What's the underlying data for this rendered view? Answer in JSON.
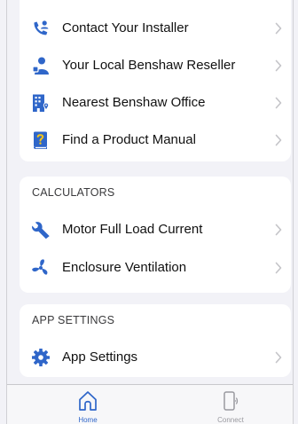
{
  "support": {
    "items": [
      {
        "label": "Contact Your Installer",
        "icon": "phone-person-icon"
      },
      {
        "label": "Your Local Benshaw Reseller",
        "icon": "person-icon"
      },
      {
        "label": "Nearest Benshaw Office",
        "icon": "office-building-icon"
      },
      {
        "label": "Find a Product Manual",
        "icon": "manual-question-icon"
      }
    ]
  },
  "calculators": {
    "header": "CALCULATORS",
    "items": [
      {
        "label": "Motor Full Load Current",
        "icon": "wrench-icon"
      },
      {
        "label": "Enclosure Ventilation",
        "icon": "fan-icon"
      }
    ]
  },
  "app_settings": {
    "header": "APP SETTINGS",
    "items": [
      {
        "label": "App Settings",
        "icon": "gear-icon"
      }
    ]
  },
  "tabbar": {
    "home_label": "Home",
    "connect_label": "Connect"
  },
  "colors": {
    "accent": "#2f66c9",
    "inactive": "#9a9aa0",
    "background": "#f2f2f7"
  }
}
